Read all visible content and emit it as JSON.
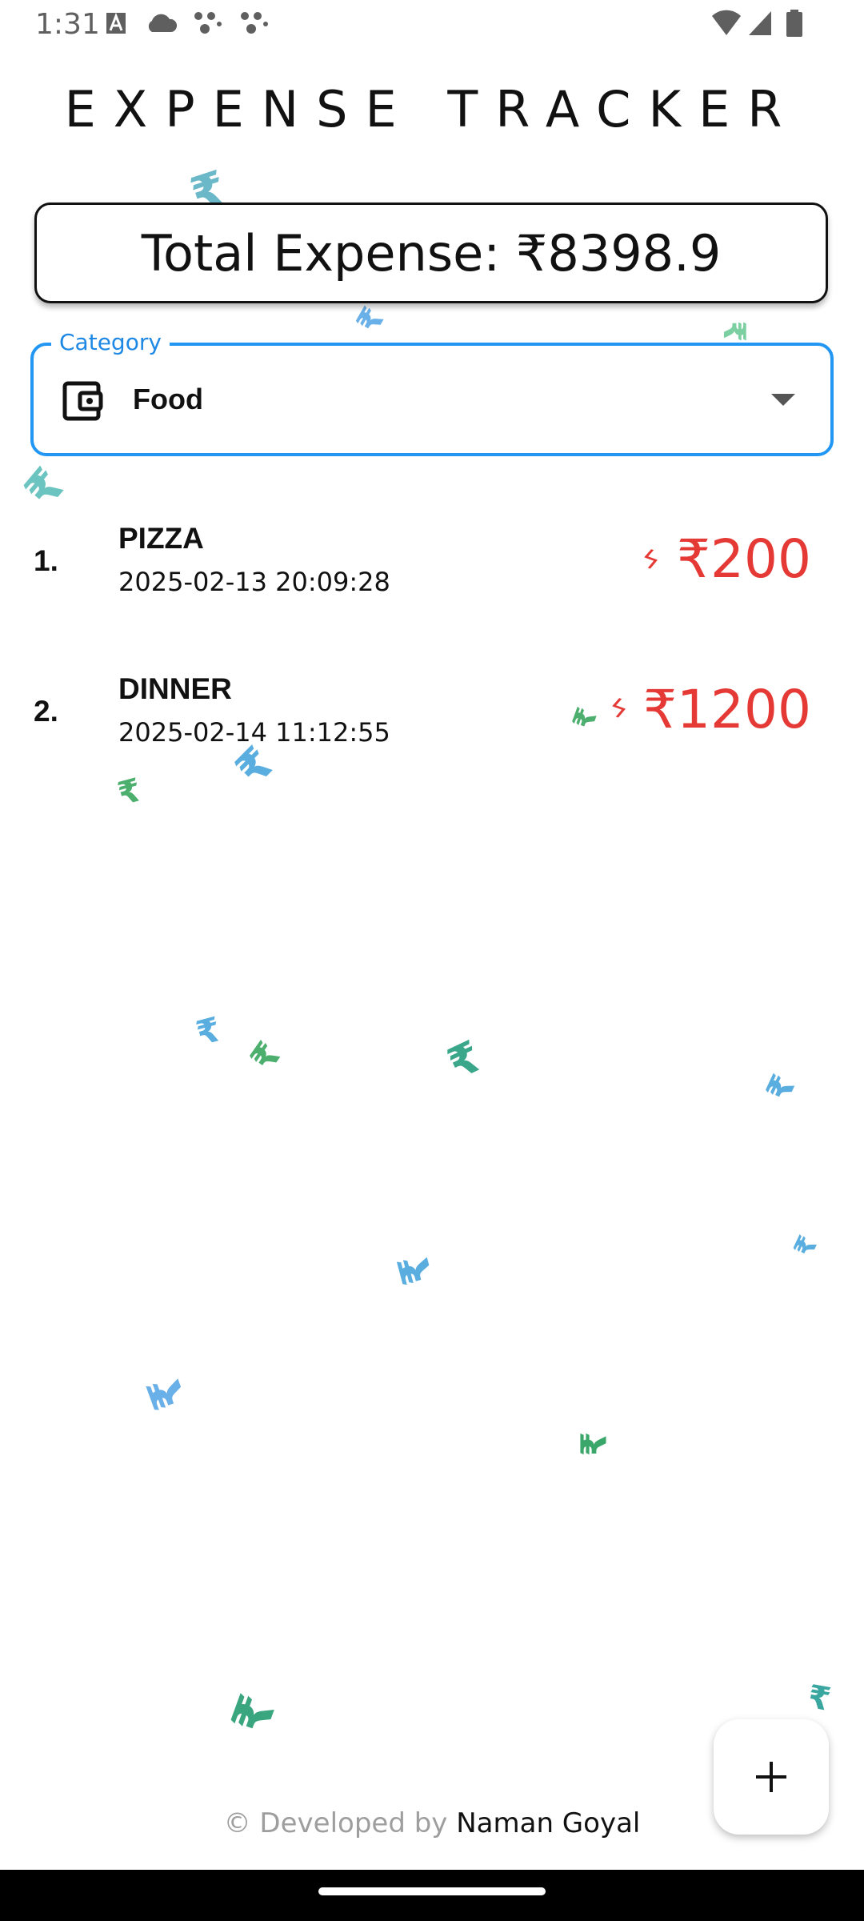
{
  "status_bar": {
    "time": "1:31"
  },
  "app": {
    "title": "EXPENSE TRACKER"
  },
  "summary": {
    "total_label": "Total Expense: ₹8398.9"
  },
  "category": {
    "label": "Category",
    "selected": "Food"
  },
  "expenses": [
    {
      "index": "1.",
      "name": "PIZZA",
      "datetime": "2025-02-13 20:09:28",
      "amount": "₹200"
    },
    {
      "index": "2.",
      "name": "DINNER",
      "datetime": "2025-02-14 11:12:55",
      "amount": "₹1200"
    }
  ],
  "decor_symbol": "₹",
  "colors": {
    "accent": "#2196f3",
    "amount": "#e53935",
    "rupee_blue": "#5aaedf",
    "rupee_green": "#4caf6e"
  },
  "footer": {
    "prefix": "© Developed by ",
    "name": "Naman Goyal"
  },
  "fab": {
    "icon": "plus-icon"
  }
}
